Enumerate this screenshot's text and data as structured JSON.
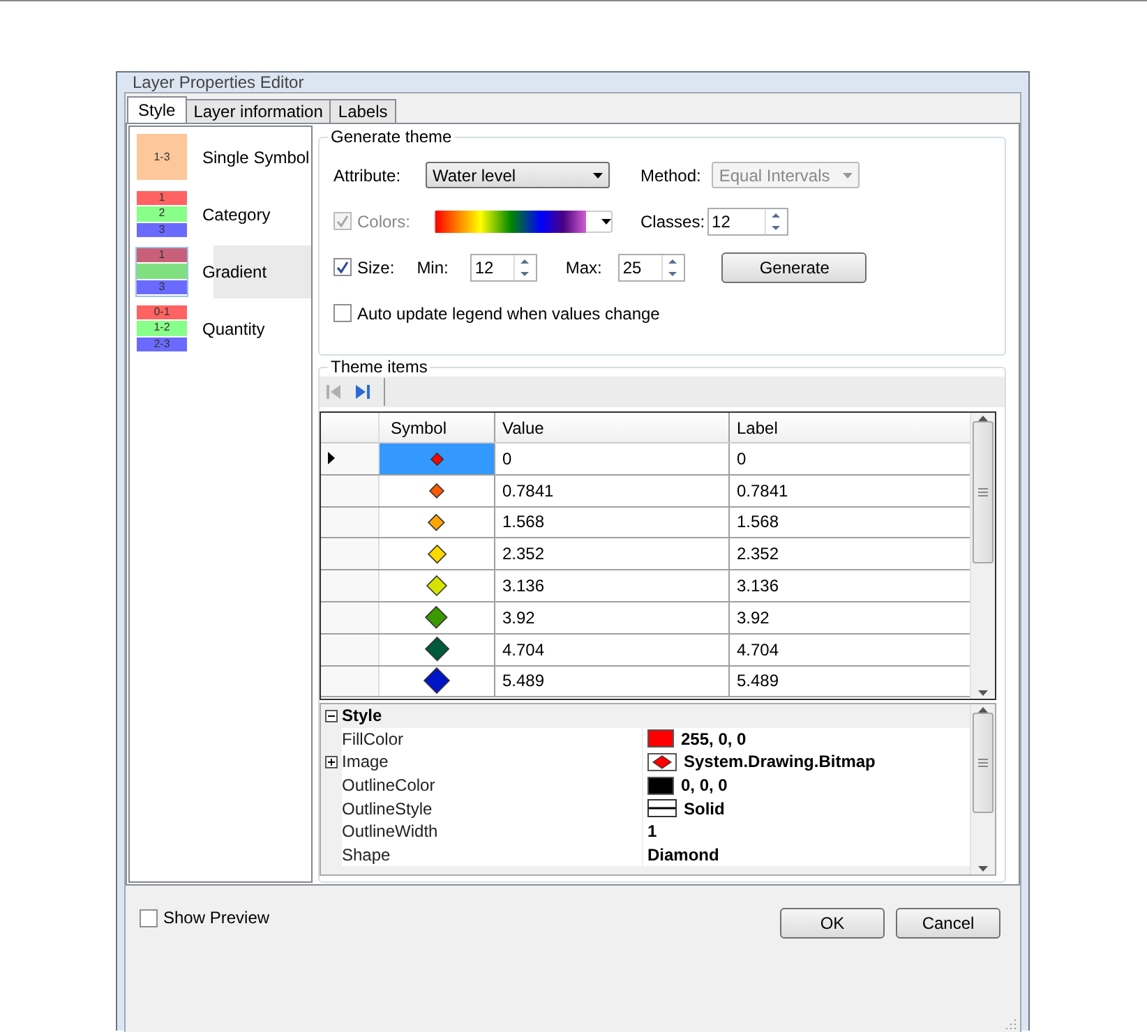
{
  "window": {
    "title": "Layer Properties Editor"
  },
  "tabs": [
    {
      "label": "Style",
      "selected": true
    },
    {
      "label": "Layer information",
      "selected": false
    },
    {
      "label": "Labels",
      "selected": false
    }
  ],
  "style_types": [
    {
      "label": "Single Symbol",
      "selected": false,
      "swatches": [
        {
          "text": "1-3",
          "color": "#fdc79b"
        }
      ]
    },
    {
      "label": "Category",
      "selected": false,
      "swatches": [
        {
          "text": "1",
          "color": "#ff6262"
        },
        {
          "text": "2",
          "color": "#88ff88"
        },
        {
          "text": "3",
          "color": "#6a6aff"
        }
      ]
    },
    {
      "label": "Gradient",
      "selected": true,
      "swatches": [
        {
          "text": "1",
          "color": "#c8607a"
        },
        {
          "color": "#80e080"
        },
        {
          "text": "3",
          "color": "#6a6aff"
        }
      ]
    },
    {
      "label": "Quantity",
      "selected": false,
      "swatches": [
        {
          "text": "0-1",
          "color": "#ff6262"
        },
        {
          "text": "1-2",
          "color": "#88ff88"
        },
        {
          "text": "2-3",
          "color": "#6a6aff"
        }
      ]
    }
  ],
  "generate_theme": {
    "title": "Generate theme",
    "attribute": {
      "label": "Attribute:",
      "value": "Water level"
    },
    "method": {
      "label": "Method:",
      "value": "Equal Intervals",
      "disabled": true
    },
    "colors": {
      "label": "Colors:",
      "checked": true,
      "disabled": true
    },
    "classes": {
      "label": "Classes:",
      "value": "12"
    },
    "size": {
      "label": "Size:",
      "checked": true
    },
    "min": {
      "label": "Min:",
      "value": "12"
    },
    "max": {
      "label": "Max:",
      "value": "25"
    },
    "generate_button": "Generate",
    "auto_update": {
      "label": "Auto update legend when values change",
      "checked": false
    }
  },
  "theme_items": {
    "title": "Theme items",
    "nav": [
      {
        "kind": "first",
        "disabled": true
      },
      {
        "kind": "last",
        "disabled": false
      }
    ],
    "columns": [
      "Symbol",
      "Value",
      "Label"
    ],
    "rows": [
      {
        "color": "#ff0000",
        "value": "0",
        "label": "0",
        "selected": true
      },
      {
        "color": "#ff5a00",
        "value": "0.7841",
        "label": "0.7841",
        "selected": false
      },
      {
        "color": "#ffa500",
        "value": "1.568",
        "label": "1.568",
        "selected": false
      },
      {
        "color": "#ffd800",
        "value": "2.352",
        "label": "2.352",
        "selected": false
      },
      {
        "color": "#d4e400",
        "value": "3.136",
        "label": "3.136",
        "selected": false
      },
      {
        "color": "#3c9a00",
        "value": "3.92",
        "label": "3.92",
        "selected": false
      },
      {
        "color": "#005a3c",
        "value": "4.704",
        "label": "4.704",
        "selected": false
      },
      {
        "color": "#0014c8",
        "value": "5.489",
        "label": "5.489",
        "selected": false
      }
    ]
  },
  "properties": {
    "section": "Style",
    "expanded": true,
    "items": [
      {
        "name": "FillColor",
        "kind": "color",
        "color": "#ff0000",
        "value": "255, 0, 0"
      },
      {
        "name": "Image",
        "kind": "image",
        "expanded": false,
        "value": "System.Drawing.Bitmap"
      },
      {
        "name": "OutlineColor",
        "kind": "color",
        "color": "#000000",
        "value": "0, 0, 0"
      },
      {
        "name": "OutlineStyle",
        "kind": "line",
        "value": "Solid"
      },
      {
        "name": "OutlineWidth",
        "kind": "plain",
        "value": "1"
      },
      {
        "name": "Shape",
        "kind": "plain",
        "value": "Diamond"
      }
    ]
  },
  "show_preview": {
    "label": "Show Preview",
    "checked": false
  },
  "buttons": [
    "OK",
    "Cancel"
  ]
}
